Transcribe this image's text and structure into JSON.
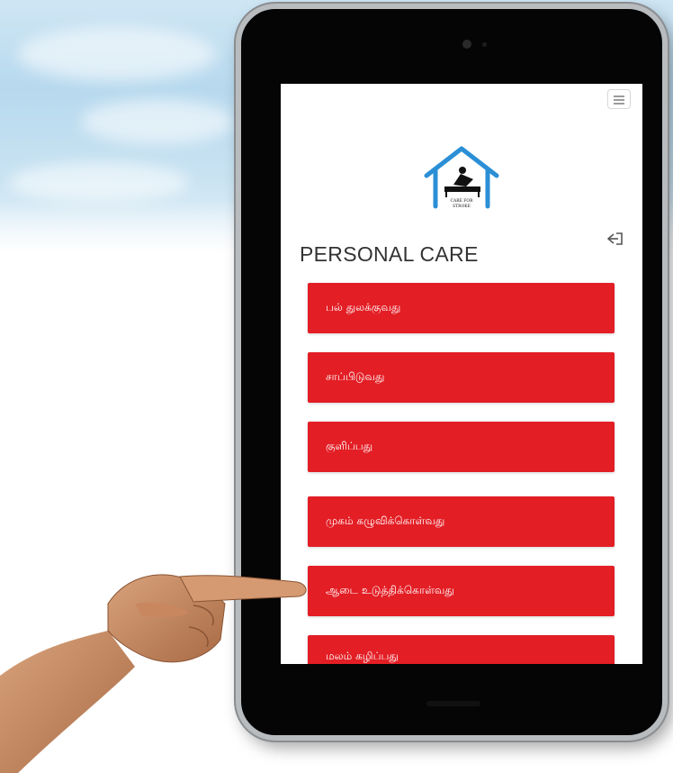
{
  "app": {
    "page_title": "PERSONAL CARE",
    "logo_text_line1": "CARE FOR",
    "logo_text_line2": "STROKE"
  },
  "care_items": [
    {
      "label": "பல் துலக்குவது"
    },
    {
      "label": "சாப்பிடுவது"
    },
    {
      "label": "குளிப்பது"
    },
    {
      "label": "முகம் கழுவிக்கொள்வது"
    },
    {
      "label": "ஆடை உடுத்திக்கொள்வது"
    },
    {
      "label": "மலம் கழிப்பது"
    }
  ],
  "icons": {
    "menu": "hamburger-menu-icon",
    "logout": "logout-icon",
    "logo": "house-caregiver-logo"
  },
  "colors": {
    "accent": "#e31e25",
    "logo_blue": "#2b8fd6",
    "title": "#333333"
  }
}
